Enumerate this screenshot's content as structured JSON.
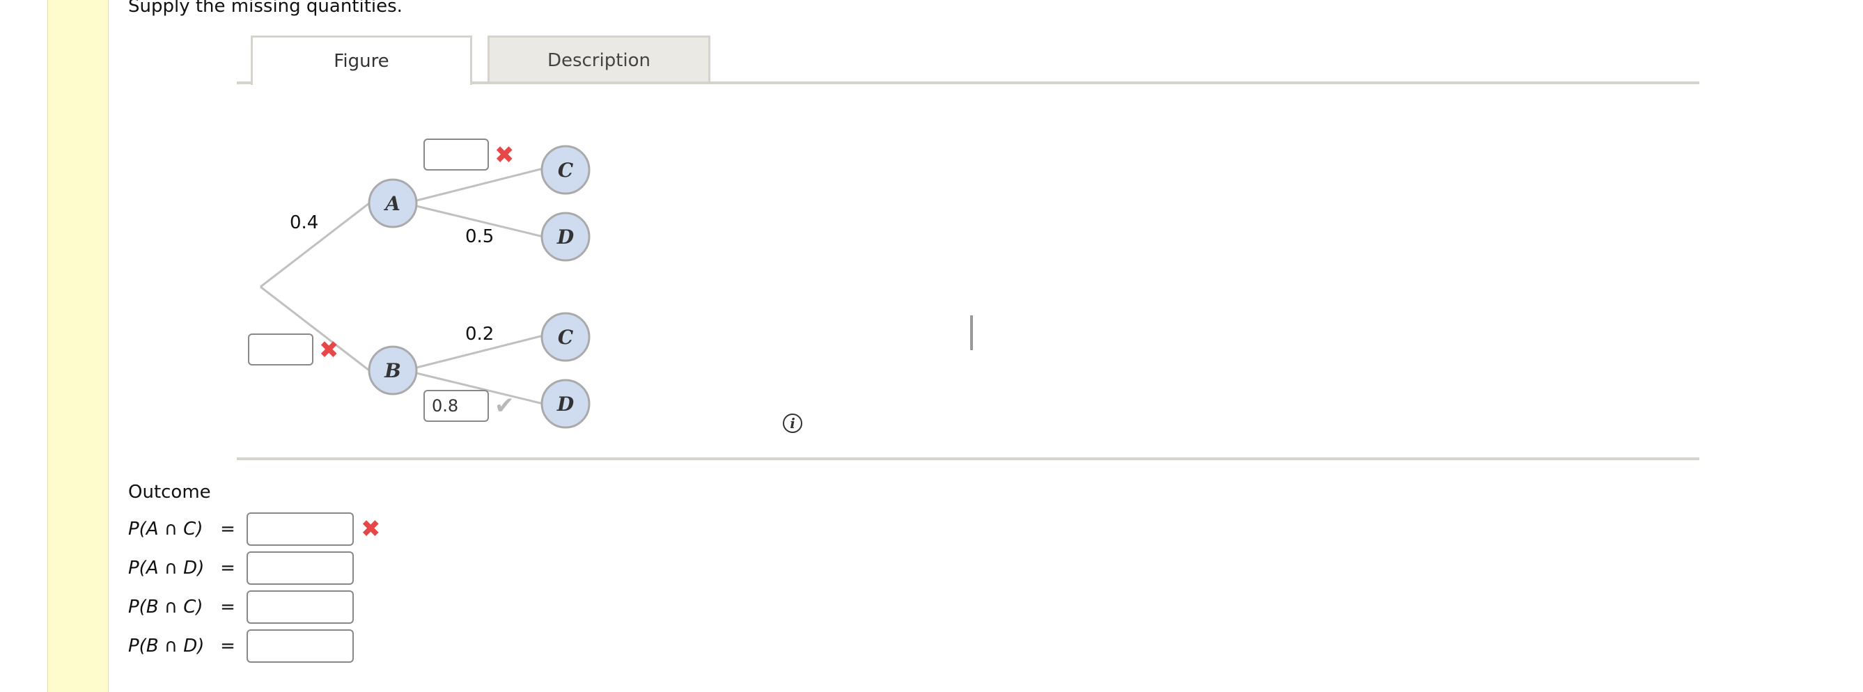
{
  "instruction": "Supply the missing quantities.",
  "tabs": [
    {
      "label": "Figure",
      "active": true
    },
    {
      "label": "Description",
      "active": false
    }
  ],
  "tree": {
    "nodes": [
      "A",
      "C",
      "D",
      "B",
      "C",
      "D"
    ],
    "edge_labels": {
      "root_A": "0.4",
      "A_D": "0.5",
      "B_C": "0.2"
    },
    "inputs": {
      "A_C": {
        "value": "",
        "status": "incorrect"
      },
      "root_B": {
        "value": "",
        "status": "incorrect"
      },
      "B_D": {
        "value": "0.8",
        "status": "correct"
      }
    },
    "node_color": "#cfdcf0",
    "line_color": "#c0c0c0"
  },
  "info_icon_glyph": "i",
  "outcome": {
    "heading": "Outcome",
    "rows": [
      {
        "label": "P(A ∩ C)",
        "eq": "=",
        "value": "",
        "status": "incorrect"
      },
      {
        "label": "P(A ∩ D)",
        "eq": "=",
        "value": "",
        "status": ""
      },
      {
        "label": "P(B ∩ C)",
        "eq": "=",
        "value": "",
        "status": ""
      },
      {
        "label": "P(B ∩ D)",
        "eq": "=",
        "value": "",
        "status": ""
      }
    ]
  },
  "marks": {
    "incorrect": "✖",
    "correct": "✔"
  },
  "colors": {
    "gutter": "#fefccd",
    "incorrect": "#e84747",
    "correct_check": "#b8b8b8",
    "tab_inactive": "#ebe9e4"
  }
}
